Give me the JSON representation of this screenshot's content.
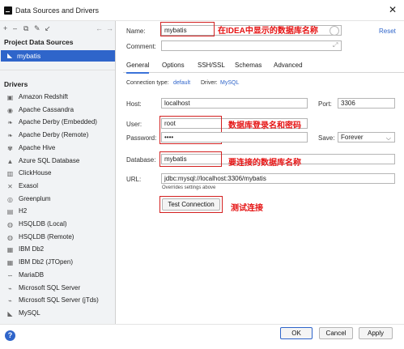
{
  "window": {
    "title": "Data Sources and Drivers"
  },
  "sidebar": {
    "project_title": "Project Data Sources",
    "project_item": "mybatis",
    "drivers_title": "Drivers",
    "drivers": [
      {
        "label": "Amazon Redshift",
        "icon": "redshift-icon"
      },
      {
        "label": "Apache Cassandra",
        "icon": "cassandra-icon"
      },
      {
        "label": "Apache Derby (Embedded)",
        "icon": "derby-icon"
      },
      {
        "label": "Apache Derby (Remote)",
        "icon": "derby-icon"
      },
      {
        "label": "Apache Hive",
        "icon": "hive-icon"
      },
      {
        "label": "Azure SQL Database",
        "icon": "azure-icon"
      },
      {
        "label": "ClickHouse",
        "icon": "clickhouse-icon"
      },
      {
        "label": "Exasol",
        "icon": "exasol-icon"
      },
      {
        "label": "Greenplum",
        "icon": "greenplum-icon"
      },
      {
        "label": "H2",
        "icon": "h2-icon"
      },
      {
        "label": "HSQLDB (Local)",
        "icon": "hsqldb-icon"
      },
      {
        "label": "HSQLDB (Remote)",
        "icon": "hsqldb-icon"
      },
      {
        "label": "IBM Db2",
        "icon": "db2-icon"
      },
      {
        "label": "IBM Db2 (JTOpen)",
        "icon": "db2-icon"
      },
      {
        "label": "MariaDB",
        "icon": "mariadb-icon"
      },
      {
        "label": "Microsoft SQL Server",
        "icon": "sqlserver-icon"
      },
      {
        "label": "Microsoft SQL Server (jTds)",
        "icon": "sqlserver-icon"
      },
      {
        "label": "MySQL",
        "icon": "mysql-icon"
      }
    ]
  },
  "form": {
    "name_label": "Name:",
    "name_value": "mybatis",
    "reset": "Reset",
    "comment_label": "Comment:",
    "tabs": [
      "General",
      "Options",
      "SSH/SSL",
      "Schemas",
      "Advanced"
    ],
    "connection_type_label": "Connection type:",
    "connection_type_value": "default",
    "driver_label": "Driver:",
    "driver_value": "MySQL",
    "host_label": "Host:",
    "host_value": "localhost",
    "port_label": "Port:",
    "port_value": "3306",
    "user_label": "User:",
    "user_value": "root",
    "password_label": "Password:",
    "password_value": "••••",
    "save_label": "Save:",
    "save_value": "Forever",
    "database_label": "Database:",
    "database_value": "mybatis",
    "url_label": "URL:",
    "url_value": "jdbc:mysql://localhost:3306/mybatis",
    "url_hint": "Overrides settings above",
    "test_connection": "Test Connection"
  },
  "annotations": {
    "name_note": "在IDEA中显示的数据库名称",
    "login_note": "数据库登录名和密码",
    "db_note": "要连接的数据库名称",
    "test_note": "测试连接"
  },
  "footer": {
    "ok": "OK",
    "cancel": "Cancel",
    "apply": "Apply"
  },
  "colors": {
    "accent": "#2f65ca",
    "annotation": "#e51414"
  }
}
